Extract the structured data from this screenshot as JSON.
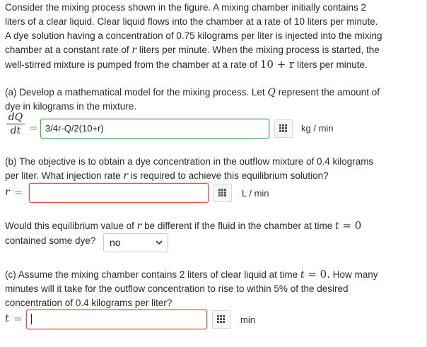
{
  "intro": {
    "line1": "Consider the mixing process shown in the figure. A mixing chamber initially contains 2",
    "line2": "liters of a clear liquid. Clear liquid flows into the chamber at a rate of 10 liters per minute.",
    "line3": "A dye solution having a concentration of 0.75 kilograms per liter is injected into the mixing",
    "line4_a": "chamber at a constant rate of ",
    "line4_r": "r",
    "line4_b": " liters per minute. When the mixing process is started, the",
    "line5_a": "well-stirred mixture is pumped from the chamber at a rate of ",
    "line5_expr": "10 + r",
    "line5_b": " liters per minute."
  },
  "part_a": {
    "line1_a": "(a) Develop a mathematical model for the mixing process. Let ",
    "line1_Q": "Q",
    "line1_b": " represent the amount of",
    "line2": "dye in kilograms in the mixture.",
    "frac_num": "dQ",
    "frac_den": "dt",
    "eq": "=",
    "answer_value": "3/4r-Q/2(10+r)",
    "unit": "kg / min"
  },
  "part_b": {
    "line1": "(b) The objective is to obtain a dye concentration in the outflow mixture of 0.4 kilograms",
    "line2_a": "per liter. What injection rate ",
    "line2_r": "r",
    "line2_b": " is required to achieve this equilibrium solution?",
    "var": "r",
    "eq": "=",
    "answer_value": "",
    "unit": "L / min"
  },
  "equilibrium_q": {
    "line1_a": "Would this equilibrium value of ",
    "line1_r": "r",
    "line1_b": " be different if the fluid in the chamber at time ",
    "line1_t": "t",
    "line1_eq": " = 0",
    "line2": "contained some dye?",
    "select_value": "no"
  },
  "part_c": {
    "line1_a": "(c) Assume the mixing chamber contains 2 liters of clear liquid at time ",
    "line1_t": "t",
    "line1_eq": " = 0.",
    "line1_b": " How many",
    "line2": "minutes will it take for the outflow concentration to rise to within 5% of the desired",
    "line3": "concentration of 0.4 kilograms per liter?",
    "var": "t",
    "eq": "=",
    "answer_value": "",
    "unit": "min"
  },
  "icons": {
    "keypad": "keypad-grid-icon",
    "dropdown": "chevron-down-icon"
  },
  "colors": {
    "correct_border": "#57a957",
    "incorrect_border": "#d9534f"
  }
}
